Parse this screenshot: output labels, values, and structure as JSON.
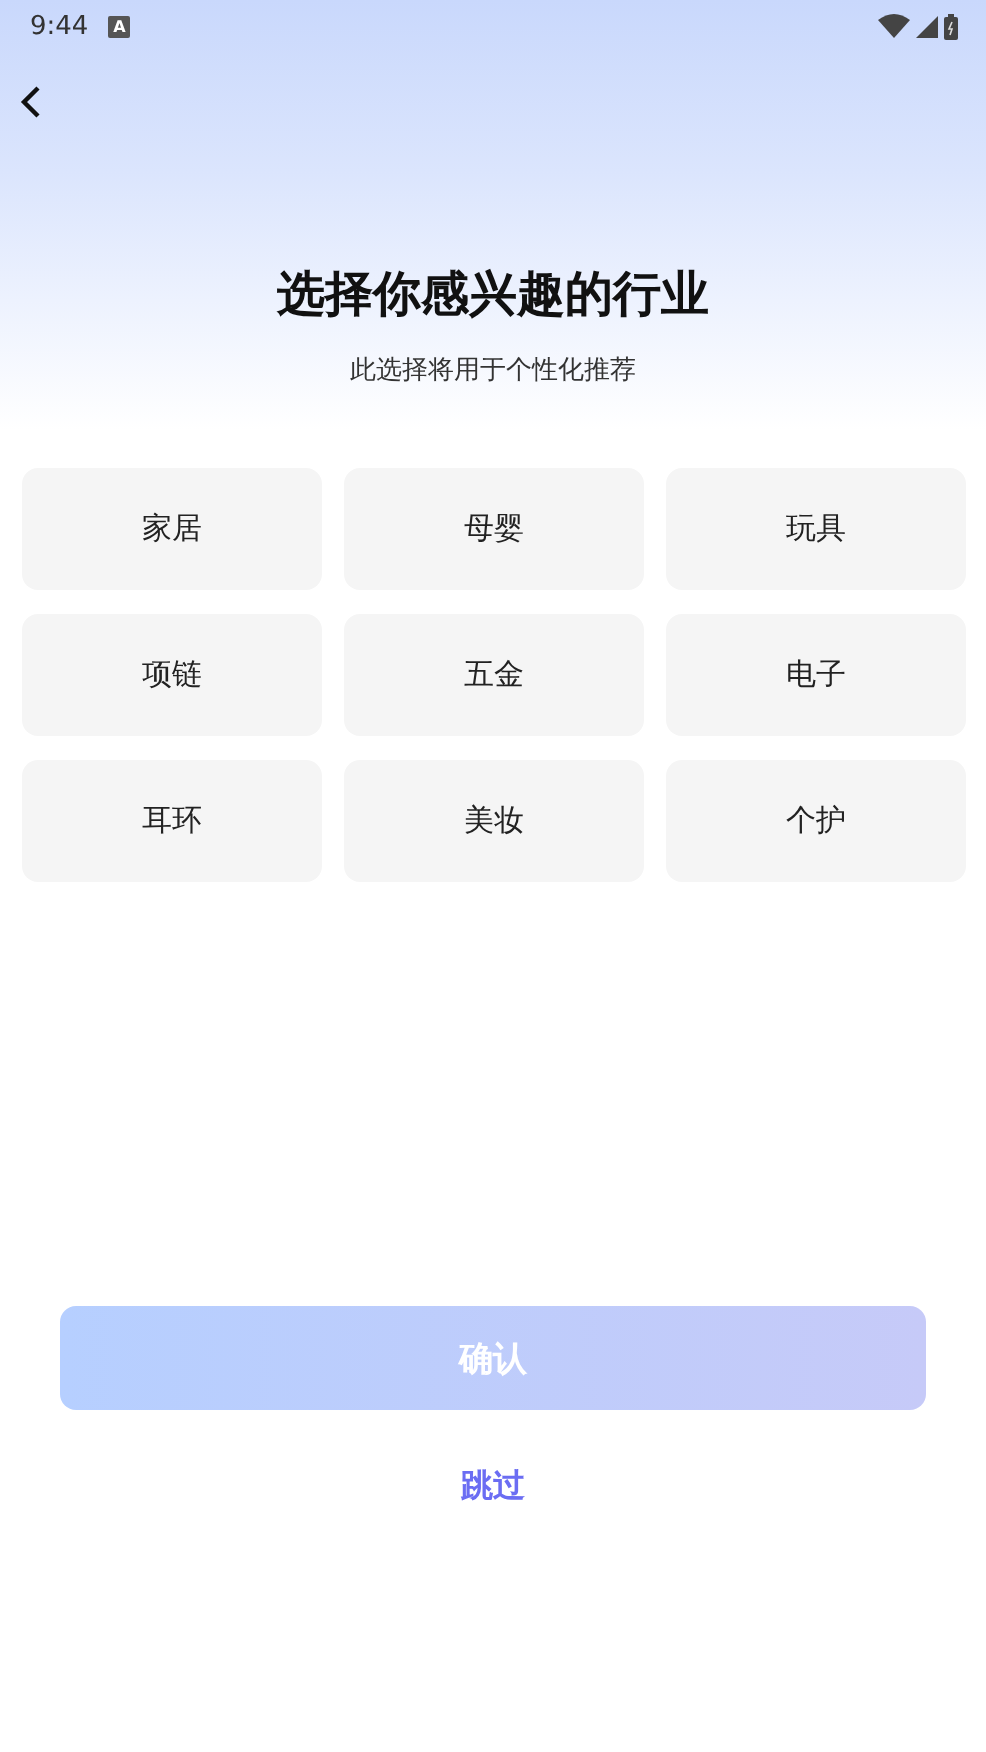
{
  "status_bar": {
    "time": "9:44",
    "notification": "A"
  },
  "title": "选择你感兴趣的行业",
  "subtitle": "此选择将用于个性化推荐",
  "industries": [
    {
      "label": "家居",
      "selected": false
    },
    {
      "label": "母婴",
      "selected": false
    },
    {
      "label": "玩具",
      "selected": false
    },
    {
      "label": "项链",
      "selected": false
    },
    {
      "label": "五金",
      "selected": false
    },
    {
      "label": "电子",
      "selected": false
    },
    {
      "label": "耳环",
      "selected": false
    },
    {
      "label": "美妆",
      "selected": false
    },
    {
      "label": "个护",
      "selected": false
    }
  ],
  "confirm_button": {
    "label": "确认",
    "disabled": true
  },
  "skip_link": "跳过"
}
